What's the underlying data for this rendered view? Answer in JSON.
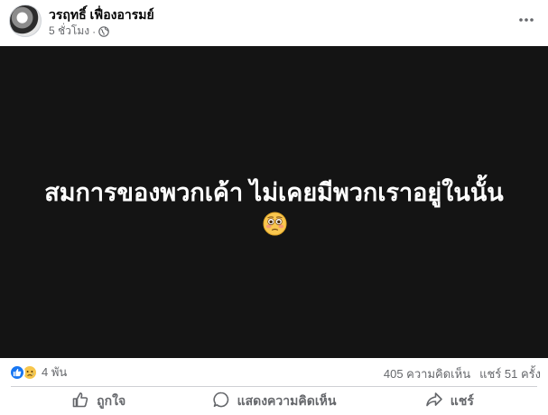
{
  "post": {
    "author": "วรฤทธิ์ เฟื่องอารมย์",
    "timestamp": "5 ชั่วโมง",
    "separator": "·",
    "audience_icon": "globe-icon",
    "more_icon": "more-options-icon",
    "text": "สมการของพวกเค้า ไม่เคยมีพวกเราอยู่ในนั้น",
    "emoji": "flushed-face-emoji",
    "background_color": "#141414",
    "text_color": "#ffffff"
  },
  "stats": {
    "reaction_icons": [
      "like-icon",
      "sad-icon"
    ],
    "reaction_count": "4 พัน",
    "comments": "405 ความคิดเห็น",
    "shares": "แชร์ 51 ครั้ง"
  },
  "actions": {
    "like_label": "ถูกใจ",
    "comment_label": "แสดงความคิดเห็น",
    "share_label": "แชร์"
  },
  "colors": {
    "like_blue": "#1877f2",
    "secondary_text": "#65676b",
    "divider": "#ced0d4"
  }
}
